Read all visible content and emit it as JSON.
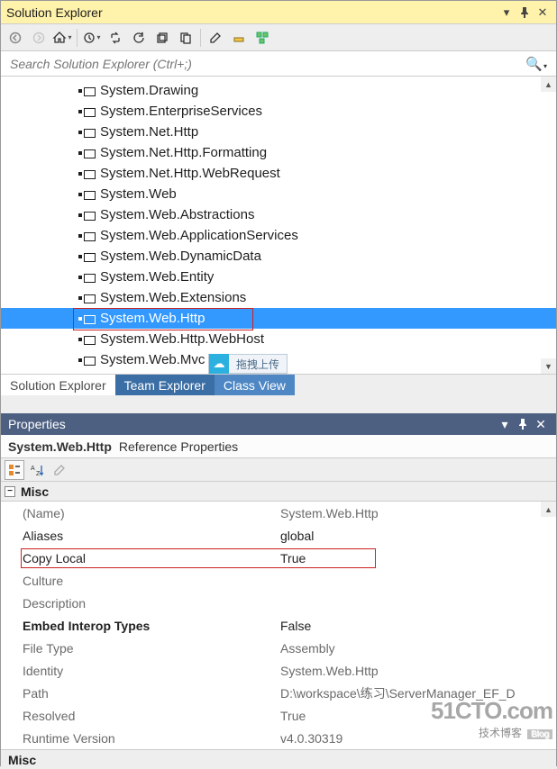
{
  "titlebar": {
    "title": "Solution Explorer"
  },
  "search": {
    "placeholder": "Search Solution Explorer (Ctrl+;)"
  },
  "tree": {
    "items": [
      {
        "label": "System.Drawing",
        "selected": false
      },
      {
        "label": "System.EnterpriseServices",
        "selected": false
      },
      {
        "label": "System.Net.Http",
        "selected": false
      },
      {
        "label": "System.Net.Http.Formatting",
        "selected": false
      },
      {
        "label": "System.Net.Http.WebRequest",
        "selected": false
      },
      {
        "label": "System.Web",
        "selected": false
      },
      {
        "label": "System.Web.Abstractions",
        "selected": false
      },
      {
        "label": "System.Web.ApplicationServices",
        "selected": false
      },
      {
        "label": "System.Web.DynamicData",
        "selected": false
      },
      {
        "label": "System.Web.Entity",
        "selected": false
      },
      {
        "label": "System.Web.Extensions",
        "selected": false
      },
      {
        "label": "System.Web.Http",
        "selected": true
      },
      {
        "label": "System.Web.Http.WebHost",
        "selected": false
      },
      {
        "label": "System.Web.Mvc",
        "selected": false
      }
    ]
  },
  "badge": {
    "text": "拖拽上传"
  },
  "se_tabs": [
    {
      "label": "Solution Explorer",
      "style": "active"
    },
    {
      "label": "Team Explorer",
      "style": "darkblue"
    },
    {
      "label": "Class View",
      "style": "lightblue"
    }
  ],
  "properties": {
    "panel_title": "Properties",
    "subject": "System.Web.Http",
    "subject_suffix": "Reference Properties",
    "category": "Misc",
    "rows": [
      {
        "name": "(Name)",
        "value": "System.Web.Http",
        "bold": false
      },
      {
        "name": "Aliases",
        "value": "global",
        "dark": true
      },
      {
        "name": "Copy Local",
        "value": "True",
        "dark": true,
        "highlight": true
      },
      {
        "name": "Culture",
        "value": ""
      },
      {
        "name": "Description",
        "value": ""
      },
      {
        "name": "Embed Interop Types",
        "value": "False",
        "bold": true
      },
      {
        "name": "File Type",
        "value": "Assembly"
      },
      {
        "name": "Identity",
        "value": "System.Web.Http"
      },
      {
        "name": "Path",
        "value": "D:\\workspace\\练习\\ServerManager_EF_D"
      },
      {
        "name": "Resolved",
        "value": "True"
      },
      {
        "name": "Runtime Version",
        "value": "v4.0.30319"
      }
    ],
    "footer": "Misc"
  },
  "watermark": {
    "line1": "51CTO.com",
    "line2": "技术博客",
    "blog": "Blog"
  }
}
